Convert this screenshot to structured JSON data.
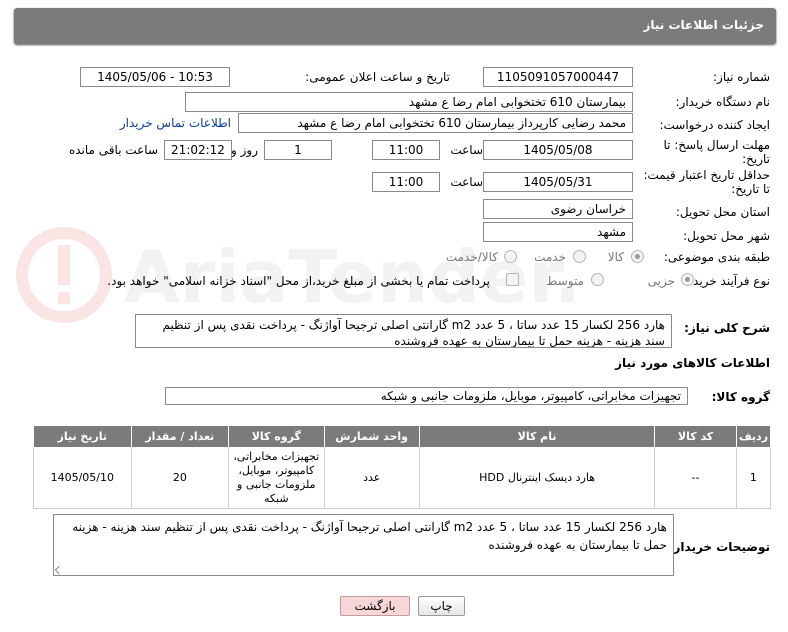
{
  "header": {
    "title": "جزئیات اطلاعات نیاز"
  },
  "watermark": {
    "text": "AriaTender.net"
  },
  "form": {
    "need_number_label": "شماره نیاز:",
    "need_number": "1105091057000447",
    "announce_label": "تاریخ و ساعت اعلان عمومی:",
    "announce_value": "1405/05/06 - 10:53",
    "buyer_org_label": "نام دستگاه خریدار:",
    "buyer_org": "بیمارستان 610 تختخوابی امام رضا ع  مشهد",
    "creator_label": "ایجاد کننده درخواست:",
    "creator": "محمد رضایی کارپرداز بیمارستان 610 تختخوابی امام رضا ع  مشهد",
    "contact_link": "اطلاعات تماس خریدار",
    "deadline_label_1": "مهلت ارسال پاسخ: تا",
    "deadline_label_2": "تاریخ:",
    "deadline_date": "1405/05/08",
    "time_label": "ساعت",
    "deadline_time": "11:00",
    "days": "1",
    "days_label": "روز و",
    "remaining_time": "21:02:12",
    "remaining_label": "ساعت باقی مانده",
    "validity_label_1": "حداقل تاریخ اعتبار قیمت:",
    "validity_label_2": "تا تاریخ:",
    "validity_date": "1405/05/31",
    "validity_time": "11:00",
    "province_label": "استان محل تحویل:",
    "province": "خراسان رضوی",
    "city_label": "شهر محل تحویل:",
    "city": "مشهد",
    "category_label": "طبقه بندی موضوعی:",
    "category_options": [
      "کالا",
      "خدمت",
      "کالا/خدمت"
    ],
    "process_label": "نوع فرآیند خرید :",
    "process_options": [
      "جزیی",
      "متوسط"
    ],
    "payment_note": "پرداخت تمام یا بخشی از مبلغ خرید،از محل \"اسناد خزانه اسلامی\" خواهد بود."
  },
  "description": {
    "label": "شرح کلی نیاز:",
    "text": "هارد 256 لکسار 15 عدد ساتا ، 5 عدد m2 گارانتی اصلی ترجیحا آواژنگ - پرداخت نقدی پس از تنظیم سند هزینه - هزینه حمل تا بیمارستان به عهده فروشنده"
  },
  "goods": {
    "section_title": "اطلاعات کالاهای مورد نیاز",
    "group_label": "گروه کالا:",
    "group_value": "تجهیزات مخابراتی، کامپیوتر، موبایل، ملزومات جانبی و شبکه",
    "columns": [
      "ردیف",
      "کد کالا",
      "نام کالا",
      "واحد شمارش",
      "گروه کالا",
      "تعداد / مقدار",
      "تاریخ نیاز"
    ],
    "rows": [
      {
        "row": "1",
        "code": "--",
        "name": "هارد دیسک اینترنال HDD",
        "unit": "عدد",
        "group": "تجهیزات مخابراتی، کامپیوتر، موبایل، ملزومات جانبی و شبکه",
        "qty": "20",
        "date": "1405/05/10"
      }
    ]
  },
  "buyer_notes": {
    "label": "توضیحات خریدار:",
    "text": "هارد 256 لکسار 15 عدد ساتا ، 5 عدد m2 گارانتی اصلی ترجیحا آواژنگ - پرداخت نقدی پس از تنظیم سند هزینه - هزینه حمل تا بیمارستان به عهده فروشنده"
  },
  "buttons": {
    "print": "چاپ",
    "back": "بازگشت"
  }
}
